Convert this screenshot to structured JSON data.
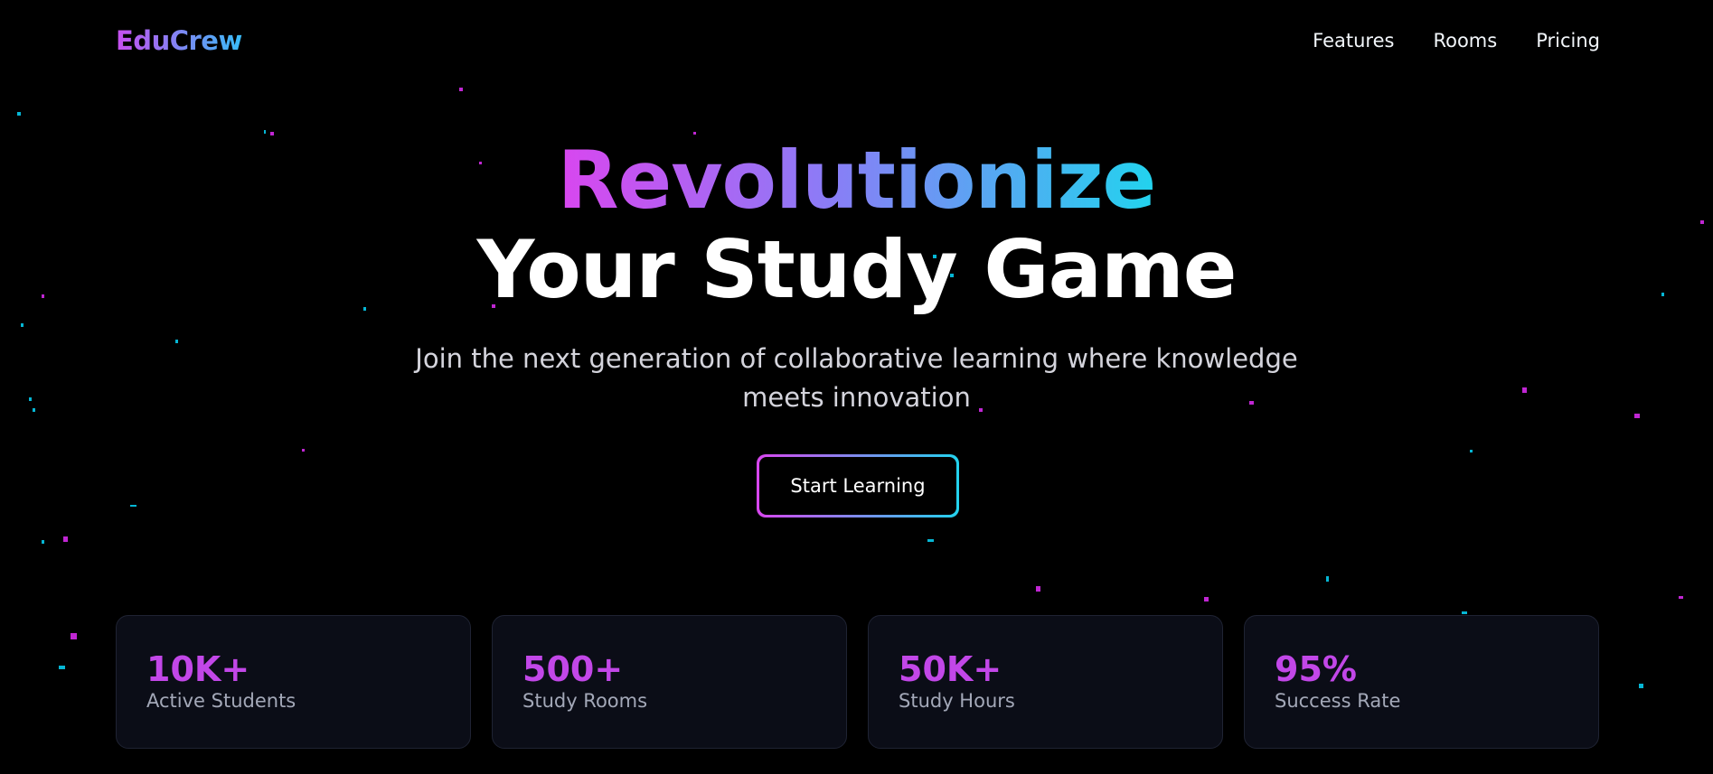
{
  "nav": {
    "logo": "EduCrew",
    "links": [
      "Features",
      "Rooms",
      "Pricing"
    ]
  },
  "hero": {
    "title_line1": "Revolutionize",
    "title_line2": "Your Study Game",
    "subtitle": "Join the next generation of collaborative learning where knowledge meets innovation",
    "cta_label": "Start Learning"
  },
  "stats": [
    {
      "value": "10K+",
      "label": "Active Students"
    },
    {
      "value": "500+",
      "label": "Study Rooms"
    },
    {
      "value": "50K+",
      "label": "Study Hours"
    },
    {
      "value": "95%",
      "label": "Success Rate"
    }
  ],
  "colors": {
    "accent_magenta": "#d946ef",
    "accent_cyan": "#22d3ee",
    "background": "#000000",
    "card": "#0b0d17"
  }
}
